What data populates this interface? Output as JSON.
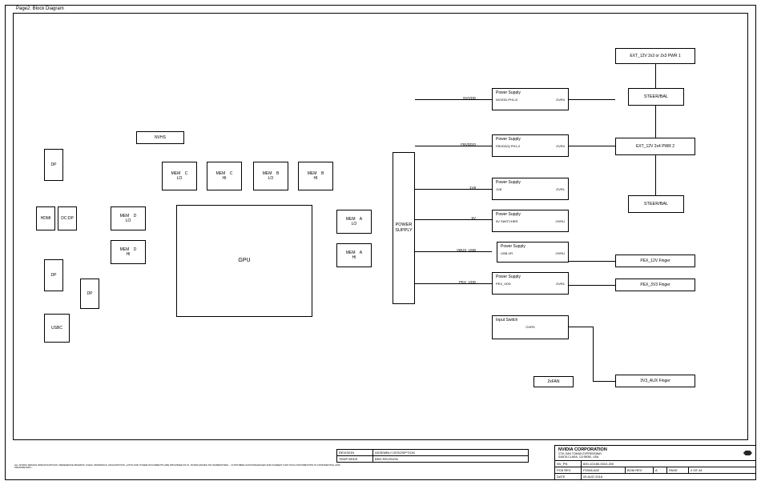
{
  "page_label": "Page2: Block Diagram",
  "connectors": {
    "dp1": "DP",
    "hdmi": "HDMI",
    "dcdp": "DC:DP",
    "dp2": "DP",
    "dp3": "DP",
    "usbc": "USBC"
  },
  "nvhs": "NVHS",
  "mem": {
    "d_lo": "MEM    D\nLO",
    "d_hi": "MEM    D\nHI",
    "c_lo": "MEM    C\nLO",
    "c_hi": "MEM    C\nHI",
    "b_lo": "MEM    B\nLO",
    "b_hi": "MEM    B\nHI",
    "a_lo": "MEM    A\nLO",
    "a_hi": "MEM    A\nHI"
  },
  "gpu": "GPU",
  "power_supply_block": "POWER SUPPLY",
  "rails": {
    "nvvdd": "NVVDD",
    "fbvddq": "FBVDDQ",
    "v1v8": "1V8",
    "v5v": "5V",
    "vbus_usb": "VBUS_USB",
    "pex_vdd": "PEX_VDD"
  },
  "ps": {
    "nvvdd": {
      "title": "Power Supply",
      "sub": "NVVDD-PH1-8",
      "ovr": "OVR4"
    },
    "fbvddq": {
      "title": "Power Supply",
      "sub": "FBVDD/Q PH1-2",
      "ovr": "OVR4"
    },
    "v1v8": {
      "title": "Power Supply",
      "sub": "1V8",
      "ovr": "OVR1"
    },
    "v5v": {
      "title": "Power Supply",
      "sub": "5V SWITCHER",
      "ovr": "OVRU"
    },
    "vbus": {
      "title": "Power Supply",
      "sub": "USB-VR",
      "ovr": "OVRU"
    },
    "pex": {
      "title": "Power Supply",
      "sub": "PEX_VDD",
      "ovr": "OVR1"
    },
    "isw": {
      "title": "Input Switch",
      "sub": "OVRS",
      "ovr": ""
    }
  },
  "right": {
    "ext1": "EXT_12V 2x3 or 2x3 PWR 1",
    "steer1": "STEER/BAL",
    "ext2": "EXT_12V 2x4 PWR 2",
    "steer2": "STEER/BAL",
    "pex12v": "PEX_12V Finger",
    "pex3v3": "PEX_3V3 Finger",
    "aux3v3": "3V3_AUX Finger",
    "fan": "2xFAN"
  },
  "titleblock": {
    "corp": "NVIDIA CORPORATION",
    "addr1": "2701 SAN TOMAS EXPRESSWAY",
    "addr2": "SANTA CLARA, CA 95050, USA",
    "nv_pn_l": "NV_PN",
    "nv_pn": "600-1G180-0010-200",
    "pcb_l": "PCB REV",
    "pcb": "P2008-A02",
    "bom_l": "BOM REV",
    "bom": "A",
    "page_l": "PAGE",
    "page": "2 OF 44",
    "date_l": "DATE",
    "date": "05 AUG 2018"
  },
  "rev": {
    "h1": "REVISION",
    "h2": "ASSEMBLY DESCRIPTION",
    "r1": "TEMP BRDS",
    "r2": "BRD REVISION"
  },
  "disclaimer": "ALL NVIDIA DESIGN SPECIFICATIONS, REFERENCE BOARDS, FILES, DRAWINGS, DIAGNOSTICS, LISTS AND OTHER DOCUMENTS ARE PROVIDED AS IS. NVIDIA MAKES NO WARRANTIES... CUSTOMER ACKNOWLEDGES AND AGREES THAT SUCH INFORMATION IS CONFIDENTIAL AND PROPRIETARY..."
}
